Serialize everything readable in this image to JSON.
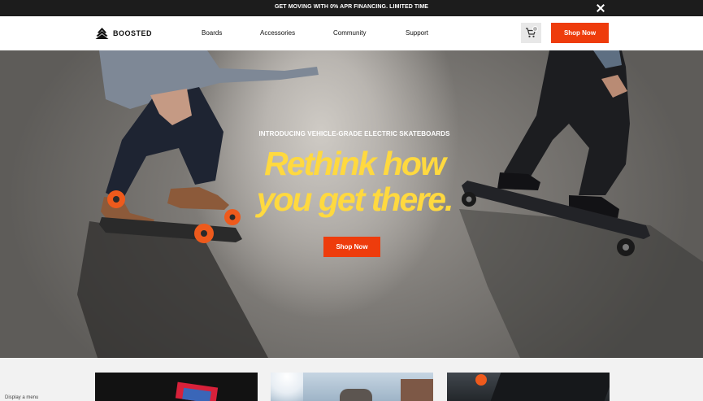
{
  "promo": {
    "text": "GET MOVING WITH 0% APR FINANCING. LIMITED TIME"
  },
  "nav": {
    "brand": "BOOSTED",
    "links": [
      {
        "label": "Boards"
      },
      {
        "label": "Accessories"
      },
      {
        "label": "Community"
      },
      {
        "label": "Support"
      }
    ],
    "shop_label": "Shop Now"
  },
  "hero": {
    "eyebrow": "INTRODUCING VEHICLE-GRADE ELECTRIC SKATEBOARDS",
    "headline_line1": "Rethink how",
    "headline_line2": "you get there.",
    "cta_label": "Shop Now"
  },
  "status_bar": {
    "text": "Display a menu"
  },
  "colors": {
    "accent": "#ee3c0c",
    "headline": "#ffd93f",
    "promo_bg": "#1c1c1c"
  },
  "icons": [
    "boosted-logo-icon",
    "close-icon",
    "cart-icon"
  ]
}
